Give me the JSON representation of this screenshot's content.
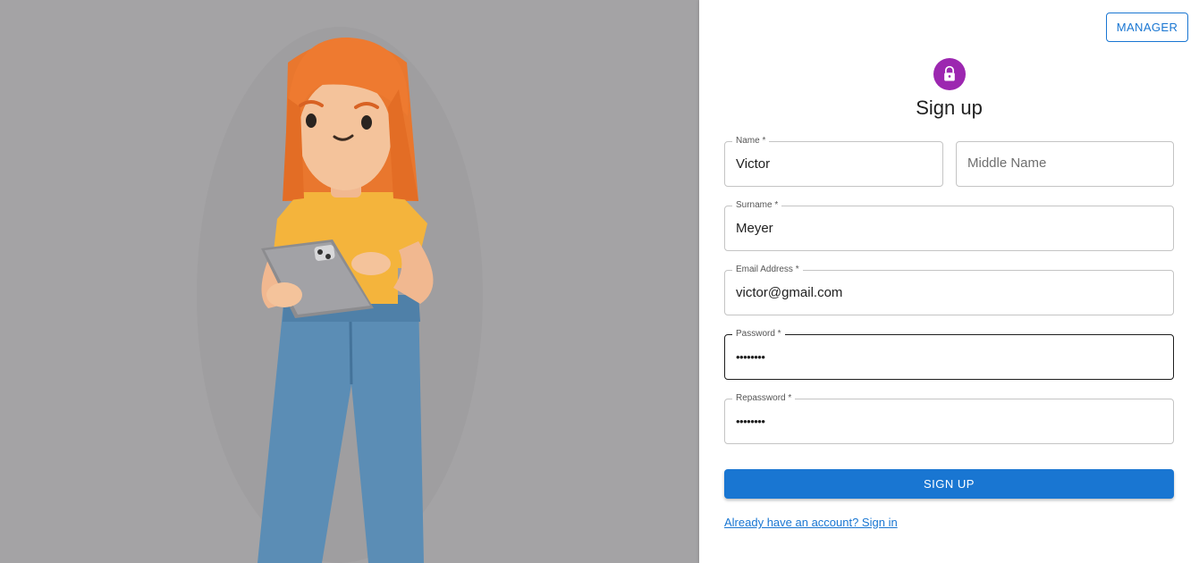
{
  "header": {
    "manager_label": "MANAGER"
  },
  "form": {
    "title": "Sign up",
    "fields": {
      "name": {
        "label": "Name *",
        "value": "Victor"
      },
      "middle_name": {
        "placeholder": "Middle Name"
      },
      "surname": {
        "label": "Surname *",
        "value": "Meyer"
      },
      "email": {
        "label": "Email Address *",
        "value": "victor@gmail.com"
      },
      "password": {
        "label": "Password *",
        "value": "••••••••"
      },
      "repassword": {
        "label": "Repassword *",
        "value": "••••••••"
      }
    },
    "submit_label": "SIGN UP",
    "signin_link": "Already have an account? Sign in"
  },
  "colors": {
    "primary": "#1976d2",
    "avatar": "#9c27b0",
    "hero_background": "#a4a3a5"
  },
  "icons": {
    "avatar_icon": "lock-icon"
  }
}
